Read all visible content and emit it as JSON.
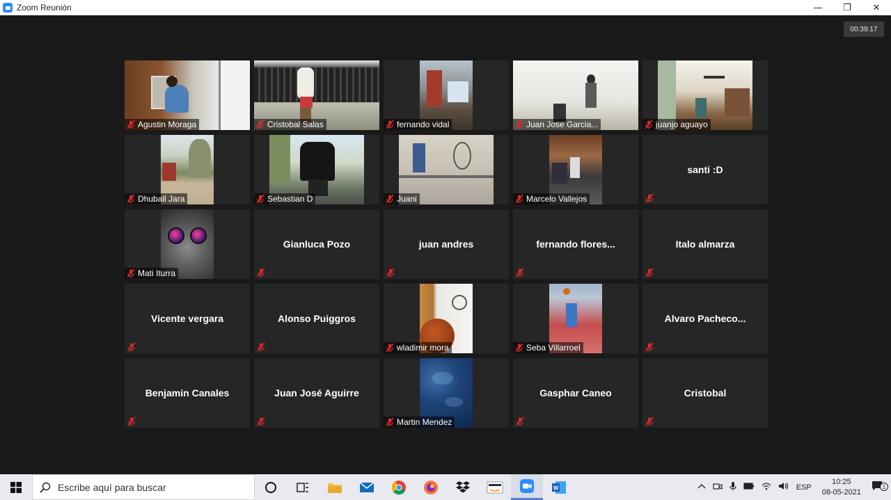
{
  "window": {
    "title": "Zoom Reunión",
    "minimize": "—",
    "restore": "❐",
    "close": "✕"
  },
  "meeting": {
    "timer": "00:39:17",
    "participants": [
      {
        "name": "Agustin Moraga",
        "video": true
      },
      {
        "name": "Cristobal Salas",
        "video": true
      },
      {
        "name": "fernando vidal",
        "video": true
      },
      {
        "name": "Juan Jose Garcia...",
        "video": true
      },
      {
        "name": "juanjo aguayo",
        "video": true
      },
      {
        "name": "Dhuball Jara",
        "video": true
      },
      {
        "name": "Sebastian D",
        "video": true
      },
      {
        "name": "Juani",
        "video": true
      },
      {
        "name": "Marcelo Vallejos",
        "video": true
      },
      {
        "name": "santi :D",
        "video": false
      },
      {
        "name": "Mati Iturra",
        "video": true
      },
      {
        "name": "Gianluca Pozo",
        "video": false
      },
      {
        "name": "juan andres",
        "video": false
      },
      {
        "name": "fernando  flores...",
        "video": false
      },
      {
        "name": "Italo almarza",
        "video": false
      },
      {
        "name": "Vicente vergara",
        "video": false
      },
      {
        "name": "Alonso Puiggros",
        "video": false
      },
      {
        "name": "wladimir mora",
        "video": true
      },
      {
        "name": "Seba Villarroel",
        "video": true
      },
      {
        "name": "Alvaro  Pacheco...",
        "video": false
      },
      {
        "name": "Benjamin Canales",
        "video": false
      },
      {
        "name": "Juan José Aguirre",
        "video": false
      },
      {
        "name": "Martin Mendez",
        "video": true
      },
      {
        "name": "Gasphar Caneo",
        "video": false
      },
      {
        "name": "Cristobal",
        "video": false
      }
    ]
  },
  "taskbar": {
    "search_placeholder": "Escribe aquí para buscar",
    "language": "ESP",
    "time": "10:25",
    "date": "08-05-2021",
    "notification_count": "1"
  },
  "colors": {
    "mute": "#e02828",
    "zoom_blue": "#2d8cff",
    "background": "#1a1a1a",
    "tile": "#262626"
  }
}
